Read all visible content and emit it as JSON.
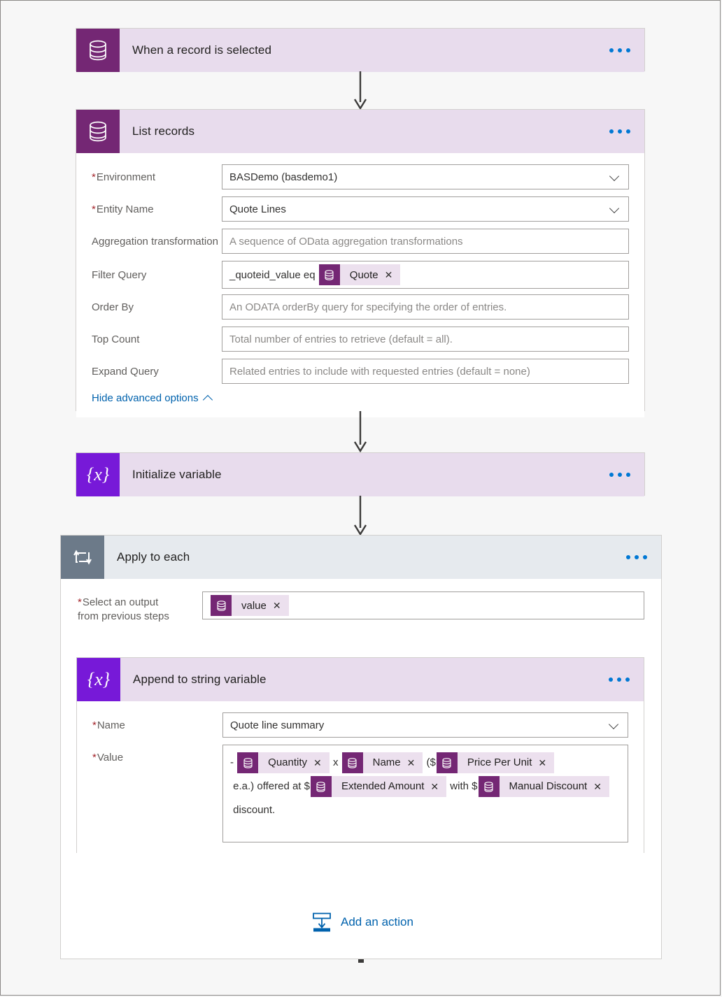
{
  "flow": {
    "steps": [
      {
        "id": "trigger",
        "title": "When a record is selected",
        "icon": "dataverse-database-icon",
        "menu": "more-commands"
      },
      {
        "id": "list-records",
        "title": "List records",
        "icon": "dataverse-database-icon",
        "menu": "more-commands",
        "fields": [
          {
            "label": "Environment",
            "required": true,
            "type": "dropdown",
            "value": "BASDemo (basdemo1)",
            "placeholder": ""
          },
          {
            "label": "Entity Name",
            "required": true,
            "type": "dropdown",
            "value": "Quote Lines",
            "placeholder": ""
          },
          {
            "label": "Aggregation transformation",
            "required": false,
            "type": "text",
            "value": "",
            "placeholder": "A sequence of OData aggregation transformations"
          },
          {
            "label": "Filter Query",
            "required": false,
            "type": "tokenized",
            "value": "",
            "placeholder": "",
            "parts": [
              {
                "kind": "text",
                "text": "_quoteid_value eq "
              },
              {
                "kind": "token",
                "text": "Quote",
                "icon": "dataverse-database-icon"
              }
            ]
          },
          {
            "label": "Order By",
            "required": false,
            "type": "text",
            "value": "",
            "placeholder": "An ODATA orderBy query for specifying the order of entries."
          },
          {
            "label": "Top Count",
            "required": false,
            "type": "text",
            "value": "",
            "placeholder": "Total number of entries to retrieve (default = all)."
          },
          {
            "label": "Expand Query",
            "required": false,
            "type": "text",
            "value": "",
            "placeholder": "Related entries to include with requested entries (default = none)"
          }
        ],
        "advanced_options_link": "Hide advanced options"
      },
      {
        "id": "initialize-variable",
        "title": "Initialize variable",
        "icon": "variable-braces-icon",
        "menu": "more-commands"
      },
      {
        "id": "apply-to-each",
        "title": "Apply to each",
        "icon": "loop-repeat-icon",
        "menu": "more-commands",
        "select_output": {
          "label_line1": "Select an output",
          "label_line2": "from previous steps",
          "required": true,
          "token": {
            "text": "value",
            "icon": "dataverse-database-icon"
          }
        },
        "nested_step": {
          "id": "append-to-string-variable",
          "title": "Append to string variable",
          "icon": "variable-braces-icon",
          "menu": "more-commands",
          "fields": [
            {
              "label": "Name",
              "required": true,
              "type": "dropdown",
              "value": "Quote line summary",
              "placeholder": ""
            },
            {
              "label": "Value",
              "required": true,
              "type": "richtext",
              "parts": [
                {
                  "kind": "text",
                  "text": "- "
                },
                {
                  "kind": "token",
                  "text": "Quantity",
                  "icon": "dataverse-database-icon"
                },
                {
                  "kind": "text",
                  "text": " x "
                },
                {
                  "kind": "token",
                  "text": "Name",
                  "icon": "dataverse-database-icon"
                },
                {
                  "kind": "text",
                  "text": " ($"
                },
                {
                  "kind": "token",
                  "text": "Price Per Unit",
                  "icon": "dataverse-database-icon"
                },
                {
                  "kind": "text",
                  "text": " e.a.) "
                },
                {
                  "kind": "text",
                  "text": "offered at $"
                },
                {
                  "kind": "token",
                  "text": "Extended Amount",
                  "icon": "dataverse-database-icon"
                },
                {
                  "kind": "text",
                  "text": " with $"
                },
                {
                  "kind": "token",
                  "text": "Manual Discount",
                  "icon": "dataverse-database-icon"
                },
                {
                  "kind": "text",
                  "text": " discount."
                }
              ]
            }
          ]
        },
        "add_action": {
          "label": "Add an action",
          "icon": "insert-action-icon"
        }
      }
    ]
  },
  "colors": {
    "dataverse_purple": "#742774",
    "variable_violet": "#7719d8",
    "loop_slate": "#6c7a89",
    "header_lavender": "#e8dced",
    "header_slate_light": "#e6eaee",
    "token_bg": "#ece0ee",
    "link_blue": "#0062ad",
    "dots_blue": "#0078d4",
    "required_red": "#a4262c"
  }
}
